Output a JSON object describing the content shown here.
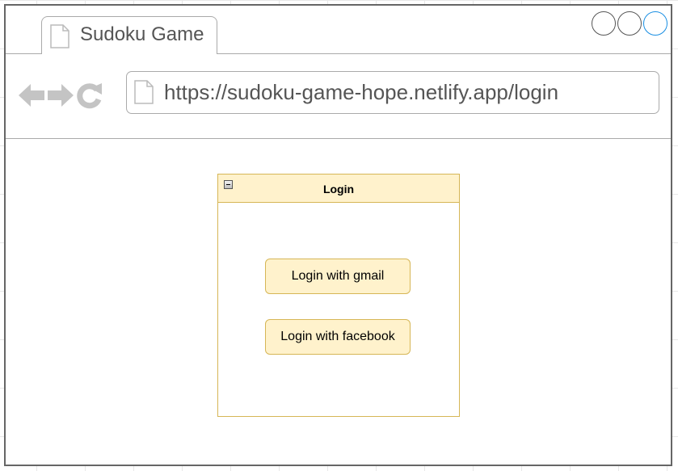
{
  "browser": {
    "tab_title": "Sudoku Game",
    "url": "https://sudoku-game-hope.netlify.app/login",
    "window_controls": [
      "circle-button",
      "circle-button",
      "circle-button-active"
    ],
    "nav_icons": [
      "back-arrow-icon",
      "forward-arrow-icon",
      "reload-icon"
    ]
  },
  "login_panel": {
    "title": "Login",
    "buttons": {
      "gmail": "Login with gmail",
      "facebook": "Login with facebook"
    }
  },
  "colors": {
    "panel_fill": "#fff2cc",
    "panel_border": "#d6b656",
    "browser_border": "#666666",
    "active_control": "#1a8fe3",
    "icon_gray": "#c4c4c4"
  }
}
